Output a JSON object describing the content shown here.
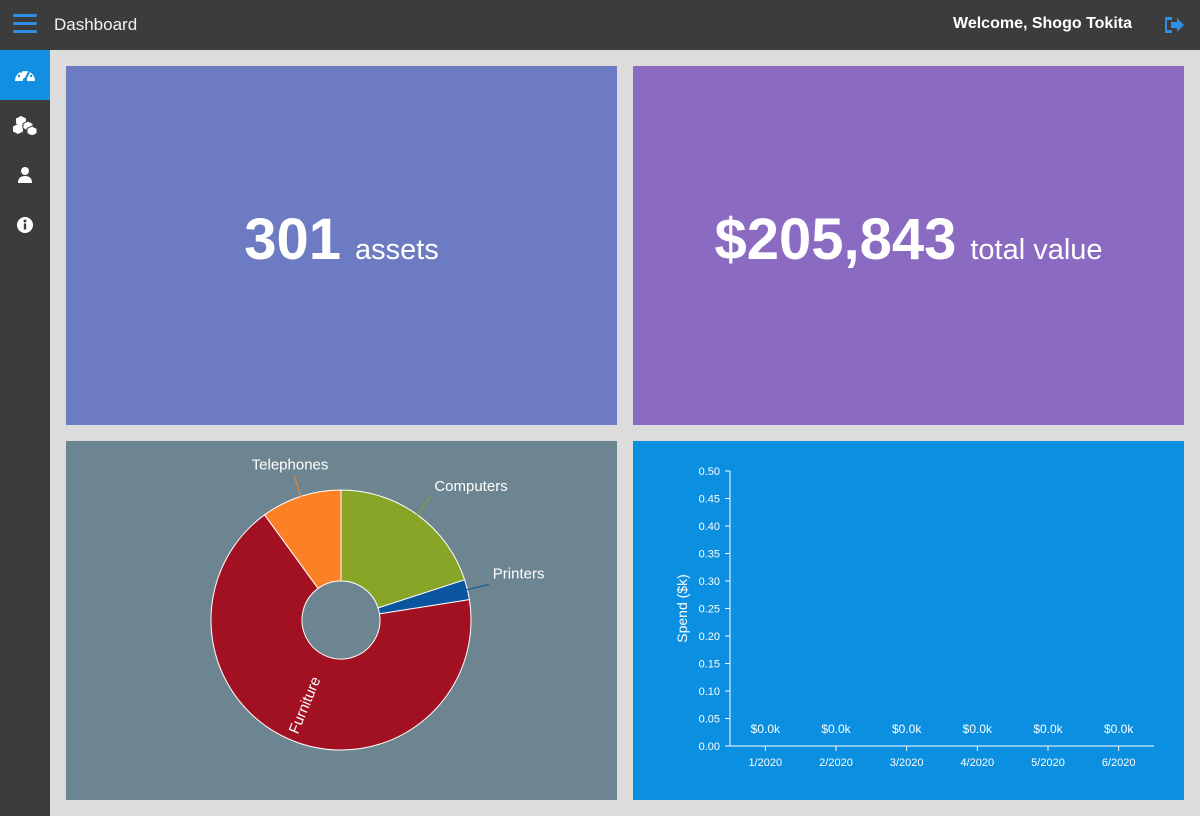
{
  "header": {
    "title": "Dashboard",
    "welcome": "Welcome, Shogo Tokita"
  },
  "sidebar": {
    "items": [
      {
        "icon": "dashboard-icon",
        "active": true
      },
      {
        "icon": "boxes-icon",
        "active": false
      },
      {
        "icon": "user-icon",
        "active": false
      },
      {
        "icon": "info-icon",
        "active": false
      }
    ]
  },
  "cards": {
    "assets": {
      "number": "301",
      "label": "assets"
    },
    "value": {
      "number": "$205,843",
      "label": "total value"
    }
  },
  "colors": {
    "accent": "#138fe2",
    "assets_card": "#6c7bc2",
    "value_card": "#8b6bc2",
    "pie_card": "#6c8590",
    "spend_card": "#0b8fe0"
  },
  "chart_data": [
    {
      "type": "pie",
      "donut": true,
      "categories": [
        "Computers",
        "Printers",
        "Furniture",
        "Telephones"
      ],
      "values": [
        20,
        2.5,
        67.5,
        10
      ],
      "colors": [
        "#88a528",
        "#0b55a0",
        "#a11122",
        "#fc8125"
      ]
    },
    {
      "type": "bar",
      "categories": [
        "1/2020",
        "2/2020",
        "3/2020",
        "4/2020",
        "5/2020",
        "6/2020"
      ],
      "values": [
        0,
        0,
        0,
        0,
        0,
        0
      ],
      "data_labels": [
        "$0.0k",
        "$0.0k",
        "$0.0k",
        "$0.0k",
        "$0.0k",
        "$0.0k"
      ],
      "ylabel": "Spend ($k)",
      "ylim": [
        0,
        0.5
      ],
      "yticks": [
        "0.00",
        "0.05",
        "0.10",
        "0.15",
        "0.20",
        "0.25",
        "0.30",
        "0.35",
        "0.40",
        "0.45",
        "0.50"
      ]
    }
  ]
}
